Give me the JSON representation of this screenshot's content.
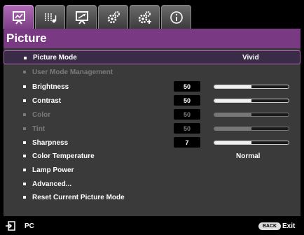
{
  "tabs": [
    {
      "icon": "picture-display-icon",
      "active": true
    },
    {
      "icon": "audio-settings-icon",
      "active": false
    },
    {
      "icon": "display-adjust-icon",
      "active": false
    },
    {
      "icon": "system-setup-basic-icon",
      "active": false
    },
    {
      "icon": "system-setup-advanced-icon",
      "active": false
    },
    {
      "icon": "information-icon",
      "active": false
    }
  ],
  "header": {
    "title": "Picture"
  },
  "menu": {
    "picture_mode": {
      "label": "Picture Mode",
      "value": "Vivid"
    },
    "user_mode_management": {
      "label": "User Mode Management"
    },
    "brightness": {
      "label": "Brightness",
      "value": "50",
      "level": 50
    },
    "contrast": {
      "label": "Contrast",
      "value": "50",
      "level": 50
    },
    "color": {
      "label": "Color",
      "value": "50",
      "level": 50
    },
    "tint": {
      "label": "Tint",
      "value": "50",
      "level": 50
    },
    "sharpness": {
      "label": "Sharpness",
      "value": "7",
      "level": 50
    },
    "color_temperature": {
      "label": "Color Temperature",
      "value": "Normal"
    },
    "lamp_power": {
      "label": "Lamp Power"
    },
    "advanced": {
      "label": "Advanced..."
    },
    "reset": {
      "label": "Reset Current Picture Mode"
    }
  },
  "footer": {
    "source_icon": "input-source-icon",
    "source_label": "PC",
    "back_badge": "BACK",
    "exit_label": "Exit"
  },
  "colors": {
    "accent": "#7a3a83",
    "panel": "#3a3a3a",
    "disabled": "#7a7a7a"
  }
}
